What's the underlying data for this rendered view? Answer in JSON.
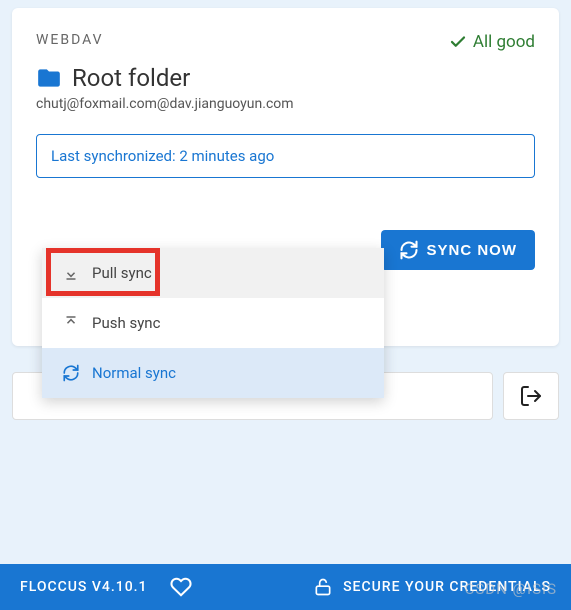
{
  "card": {
    "protocol": "WEBDAV",
    "status_label": "All good",
    "folder_name": "Root folder",
    "account": "chutj@foxmail.com@dav.jianguoyun.com",
    "sync_status": "Last synchronized: 2 minutes ago",
    "sync_now_label": "SYNC NOW"
  },
  "dropdown": {
    "pull_label": "Pull sync",
    "push_label": "Push sync",
    "normal_label": "Normal sync"
  },
  "footer": {
    "version": "FLOCCUS V4.10.1",
    "secure_label": "SECURE YOUR CREDENTIALS"
  },
  "watermark": "CSDN @ISIS",
  "colors": {
    "accent": "#1976d2",
    "success": "#2e7d32",
    "highlight": "#e5332a"
  }
}
